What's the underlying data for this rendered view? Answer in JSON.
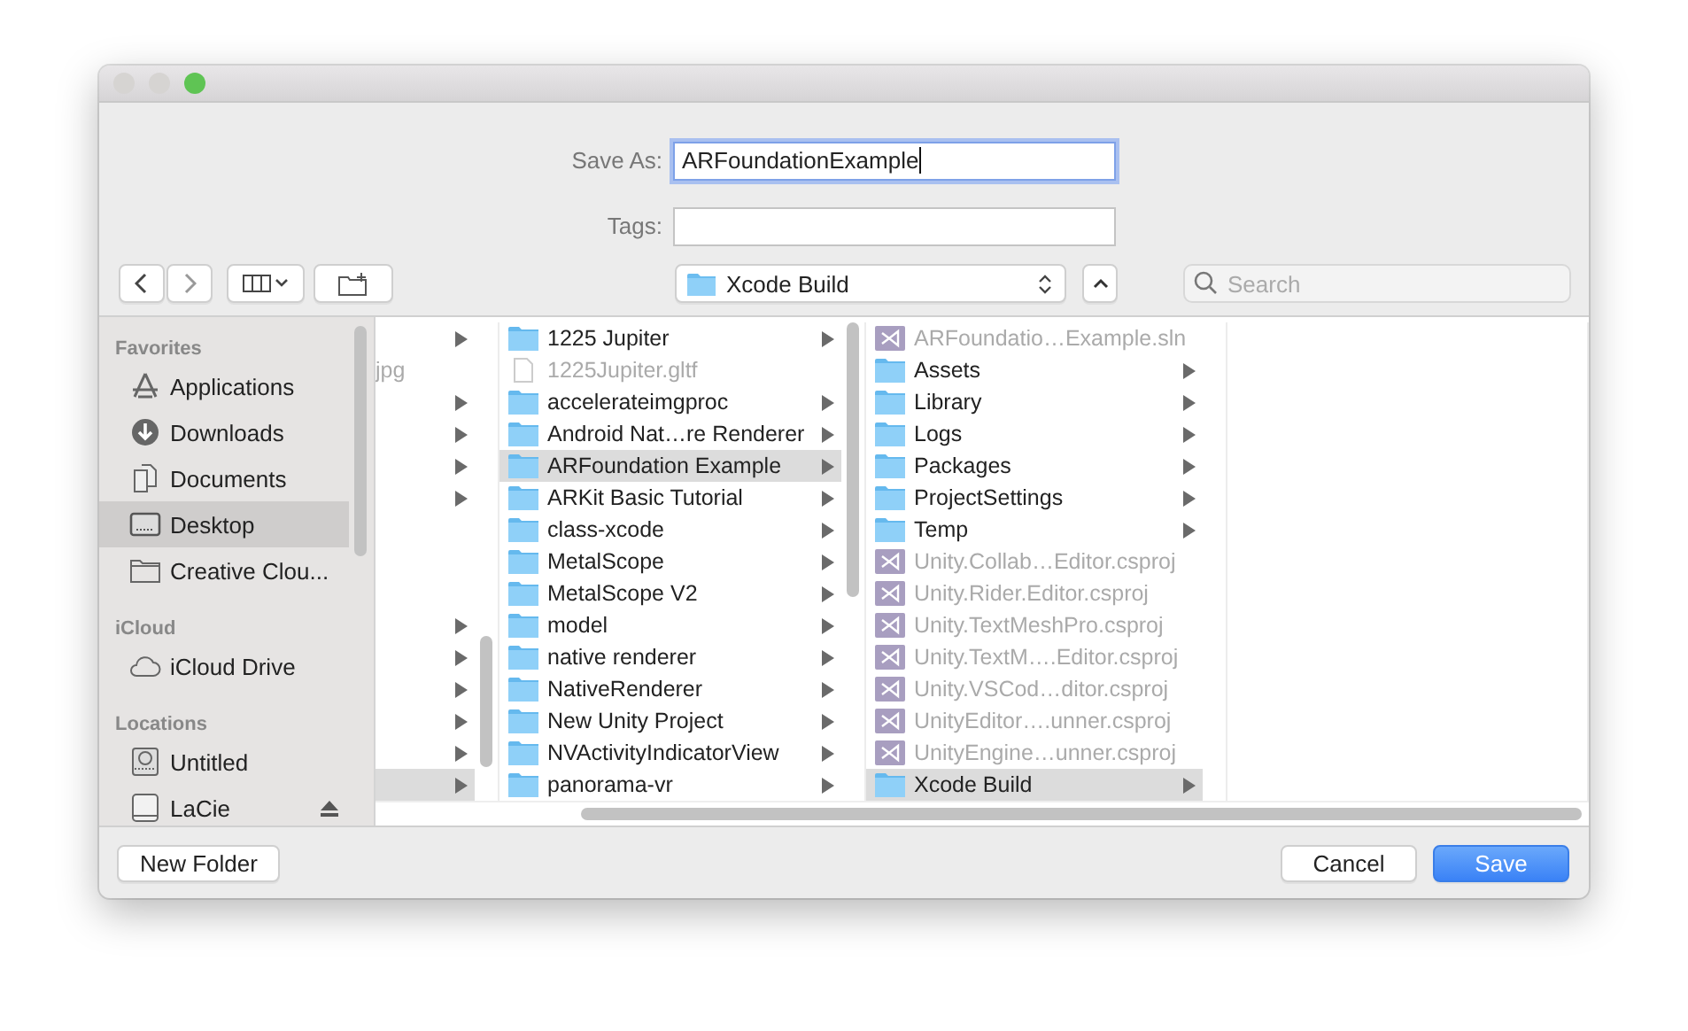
{
  "window": {
    "traffic_lights": [
      {
        "color": "#d6d4d2"
      },
      {
        "color": "#d6d4d2"
      },
      {
        "color": "#5fc454"
      }
    ]
  },
  "form": {
    "save_as": {
      "label": "Save As:",
      "value": "ARFoundationExample",
      "focused": true
    },
    "tags": {
      "label": "Tags:"
    }
  },
  "toolbar": {
    "path": "Xcode Build",
    "search": {
      "placeholder": "Search"
    }
  },
  "sidebar": [
    {
      "heading": "Favorites",
      "items": [
        {
          "label": "Applications",
          "kind": "applications",
          "selected": false
        },
        {
          "label": "Downloads",
          "kind": "downloads",
          "selected": false
        },
        {
          "label": "Documents",
          "kind": "documents",
          "selected": false
        },
        {
          "label": "Desktop",
          "kind": "desktop",
          "selected": true
        },
        {
          "label": "Creative Clou...",
          "kind": "folder",
          "selected": false
        }
      ]
    },
    {
      "heading": "iCloud",
      "items": [
        {
          "label": "iCloud Drive",
          "kind": "cloud",
          "selected": false
        }
      ]
    },
    {
      "heading": "Locations",
      "items": [
        {
          "label": "Untitled",
          "kind": "disk",
          "selected": false
        },
        {
          "label": "LaCie",
          "kind": "drive",
          "selected": false,
          "eject": true
        }
      ]
    }
  ],
  "columns": [
    {
      "items": [
        {
          "kind": "folder",
          "selected": false
        },
        {
          "kind": "text",
          "label": "jpg",
          "selected": false
        },
        {
          "kind": "folder",
          "selected": false
        },
        {
          "kind": "folder",
          "selected": false
        },
        {
          "kind": "folder",
          "selected": false
        },
        {
          "kind": "folder",
          "selected": false
        },
        {
          "kind": "blank"
        },
        {
          "kind": "blank"
        },
        {
          "kind": "blank"
        },
        {
          "kind": "folder",
          "selected": false
        },
        {
          "kind": "folder",
          "selected": false
        },
        {
          "kind": "folder",
          "selected": false
        },
        {
          "kind": "folder",
          "selected": false
        },
        {
          "kind": "folder",
          "selected": false
        },
        {
          "kind": "folder",
          "selected": true
        }
      ]
    },
    {
      "items": [
        {
          "kind": "folder",
          "label": "1225 Jupiter",
          "selected": false,
          "disabled": false
        },
        {
          "kind": "file",
          "label": "1225Jupiter.gltf",
          "selected": false,
          "disabled": true
        },
        {
          "kind": "folder",
          "label": "accelerateimgproc",
          "selected": false,
          "disabled": false
        },
        {
          "kind": "folder",
          "label": "Android Nat…re Renderer",
          "selected": false,
          "disabled": false
        },
        {
          "kind": "folder",
          "label": "ARFoundation Example",
          "selected": true,
          "disabled": false
        },
        {
          "kind": "folder",
          "label": "ARKit Basic Tutorial",
          "selected": false,
          "disabled": false
        },
        {
          "kind": "folder",
          "label": "class-xcode",
          "selected": false,
          "disabled": false
        },
        {
          "kind": "folder",
          "label": "MetalScope",
          "selected": false,
          "disabled": false
        },
        {
          "kind": "folder",
          "label": "MetalScope V2",
          "selected": false,
          "disabled": false
        },
        {
          "kind": "folder",
          "label": "model",
          "selected": false,
          "disabled": false
        },
        {
          "kind": "folder",
          "label": "native renderer",
          "selected": false,
          "disabled": false
        },
        {
          "kind": "folder",
          "label": "NativeRenderer",
          "selected": false,
          "disabled": false
        },
        {
          "kind": "folder",
          "label": "New Unity Project",
          "selected": false,
          "disabled": false
        },
        {
          "kind": "folder",
          "label": "NVActivityIndicatorView",
          "selected": false,
          "disabled": false
        },
        {
          "kind": "folder",
          "label": "panorama-vr",
          "selected": false,
          "disabled": false
        }
      ]
    },
    {
      "items": [
        {
          "kind": "project",
          "label": "ARFoundatio…Example.sln",
          "selected": false,
          "disabled": true
        },
        {
          "kind": "folder",
          "label": "Assets",
          "selected": false,
          "disabled": false
        },
        {
          "kind": "folder",
          "label": "Library",
          "selected": false,
          "disabled": false
        },
        {
          "kind": "folder",
          "label": "Logs",
          "selected": false,
          "disabled": false
        },
        {
          "kind": "folder",
          "label": "Packages",
          "selected": false,
          "disabled": false
        },
        {
          "kind": "folder",
          "label": "ProjectSettings",
          "selected": false,
          "disabled": false
        },
        {
          "kind": "folder",
          "label": "Temp",
          "selected": false,
          "disabled": false
        },
        {
          "kind": "project",
          "label": "Unity.Collab…Editor.csproj",
          "selected": false,
          "disabled": true
        },
        {
          "kind": "project",
          "label": "Unity.Rider.Editor.csproj",
          "selected": false,
          "disabled": true
        },
        {
          "kind": "project",
          "label": "Unity.TextMeshPro.csproj",
          "selected": false,
          "disabled": true
        },
        {
          "kind": "project",
          "label": "Unity.TextM….Editor.csproj",
          "selected": false,
          "disabled": true
        },
        {
          "kind": "project",
          "label": "Unity.VSCod…ditor.csproj",
          "selected": false,
          "disabled": true
        },
        {
          "kind": "project",
          "label": "UnityEditor….unner.csproj",
          "selected": false,
          "disabled": true
        },
        {
          "kind": "project",
          "label": "UnityEngine…unner.csproj",
          "selected": false,
          "disabled": true
        },
        {
          "kind": "folder",
          "label": "Xcode Build",
          "selected": true,
          "disabled": false
        }
      ]
    },
    {}
  ],
  "buttons": {
    "new_folder": "New Folder",
    "cancel": "Cancel",
    "save": "Save"
  }
}
